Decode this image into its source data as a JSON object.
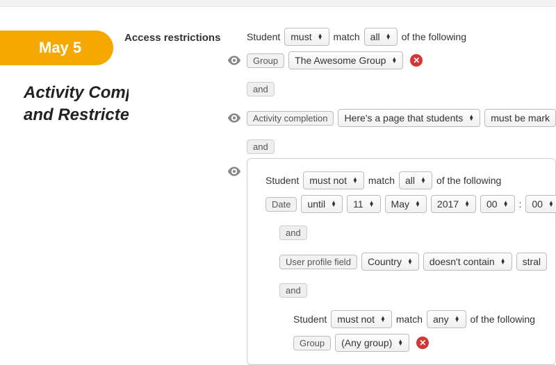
{
  "badge": {
    "date": "May 5"
  },
  "title": {
    "line1": "Activity Completion",
    "line2": "and Restricted Access"
  },
  "section_label": "Access restrictions",
  "match_sentence": {
    "student": "Student",
    "must": "must",
    "match": "match",
    "all": "all",
    "any": "any",
    "must_not": "must not",
    "of_following": "of the following"
  },
  "connector": "and",
  "group_row": {
    "label": "Group",
    "value": "The Awesome Group"
  },
  "activity_row": {
    "label": "Activity completion",
    "page": "Here's a page that students",
    "condition": "must be mark"
  },
  "date_row": {
    "label": "Date",
    "mode": "until",
    "day": "11",
    "month": "May",
    "year": "2017",
    "hour": "00",
    "colon": ":",
    "minute": "00"
  },
  "profile_row": {
    "label": "User profile field",
    "field": "Country",
    "op": "doesn't contain",
    "value": "stral"
  },
  "group_any": {
    "label": "Group",
    "value": "(Any group)"
  }
}
